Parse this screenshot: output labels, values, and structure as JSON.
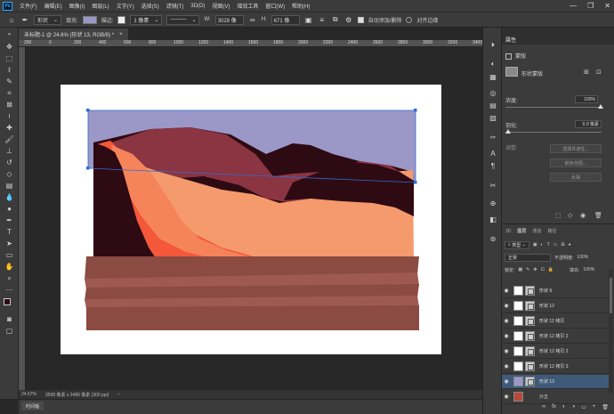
{
  "menubar": {
    "logo": "Ps",
    "items": [
      "文件(F)",
      "编辑(E)",
      "图像(I)",
      "图层(L)",
      "文字(Y)",
      "选择(S)",
      "滤镜(T)",
      "3D(D)",
      "视图(V)",
      "增效工具",
      "窗口(W)",
      "帮助(H)"
    ],
    "window_controls": [
      "—",
      "❐",
      "✕"
    ]
  },
  "options": {
    "tool_mode": "形状",
    "fill_label": "填充:",
    "stroke_label": "描边:",
    "stroke_width": "1 像素",
    "w_label": "W:",
    "w_value": "3028 像",
    "link_icon": "∞",
    "h_label": "H:",
    "h_value": "671 像",
    "auto_add_delete": "自动添加/删除",
    "align_edges": "对齐边缘",
    "fill_color": "#9b98c8"
  },
  "document": {
    "tab_title": "未标题-1 @ 24.6% (形状 13, RGB/8) *",
    "close": "×"
  },
  "ruler": {
    "ticks": [
      "200",
      "0",
      "200",
      "400",
      "600",
      "800",
      "1000",
      "1200",
      "1400",
      "1600",
      "1800",
      "2000",
      "2200",
      "2400",
      "2600",
      "2800",
      "3000",
      "3200",
      "3400",
      "3600"
    ]
  },
  "status": {
    "zoom": "24.57%",
    "doc_size": "3508 像素 x 2480 像素 (300 ppi)",
    "arrow": "›"
  },
  "timeline": {
    "tab": "时间轴"
  },
  "properties": {
    "title": "属性",
    "kind_label": "蒙版",
    "vector_mask": "形状蒙版",
    "density_label": "浓度:",
    "density_value": "100%",
    "feather_label": "羽化:",
    "feather_value": "0.0 像素",
    "refine_label": "调整:",
    "btn_select_mask": "选择并遮住...",
    "btn_color_range": "颜色范围...",
    "btn_invert": "反相"
  },
  "layers_panel": {
    "tabs": [
      "3D",
      "图层",
      "通道",
      "路径"
    ],
    "active_tab": "图层",
    "filter_kind": "类型",
    "blend_mode": "正常",
    "opacity_label": "不透明度:",
    "opacity_value": "100%",
    "lock_label": "锁定:",
    "fill_label": "填充:",
    "fill_value": "100%",
    "layers": [
      {
        "name": "形状 9",
        "selected": false
      },
      {
        "name": "形状 12",
        "selected": false
      },
      {
        "name": "形状 12 拷贝",
        "selected": false
      },
      {
        "name": "形状 12 拷贝 2",
        "selected": false
      },
      {
        "name": "形状 12 拷贝 2",
        "selected": false
      },
      {
        "name": "形状 12 拷贝 3",
        "selected": false
      },
      {
        "name": "形状 13",
        "selected": true
      },
      {
        "name": "沙丘",
        "selected": false
      }
    ],
    "footer_icons": [
      "∞",
      "fx",
      "◐",
      "◑",
      "▭",
      "+",
      "🗑"
    ]
  },
  "artwork": {
    "sky": "#9b98c8",
    "dune_dark": "#2e0a13",
    "dune_mid": "#8b3442",
    "dune_red": "#f4573a",
    "dune_orange": "#f6845a",
    "dune_peach": "#f59a6c",
    "ground_1": "#8b4a42",
    "ground_2": "#9e5a50",
    "path_color": "#2f6dd4"
  }
}
